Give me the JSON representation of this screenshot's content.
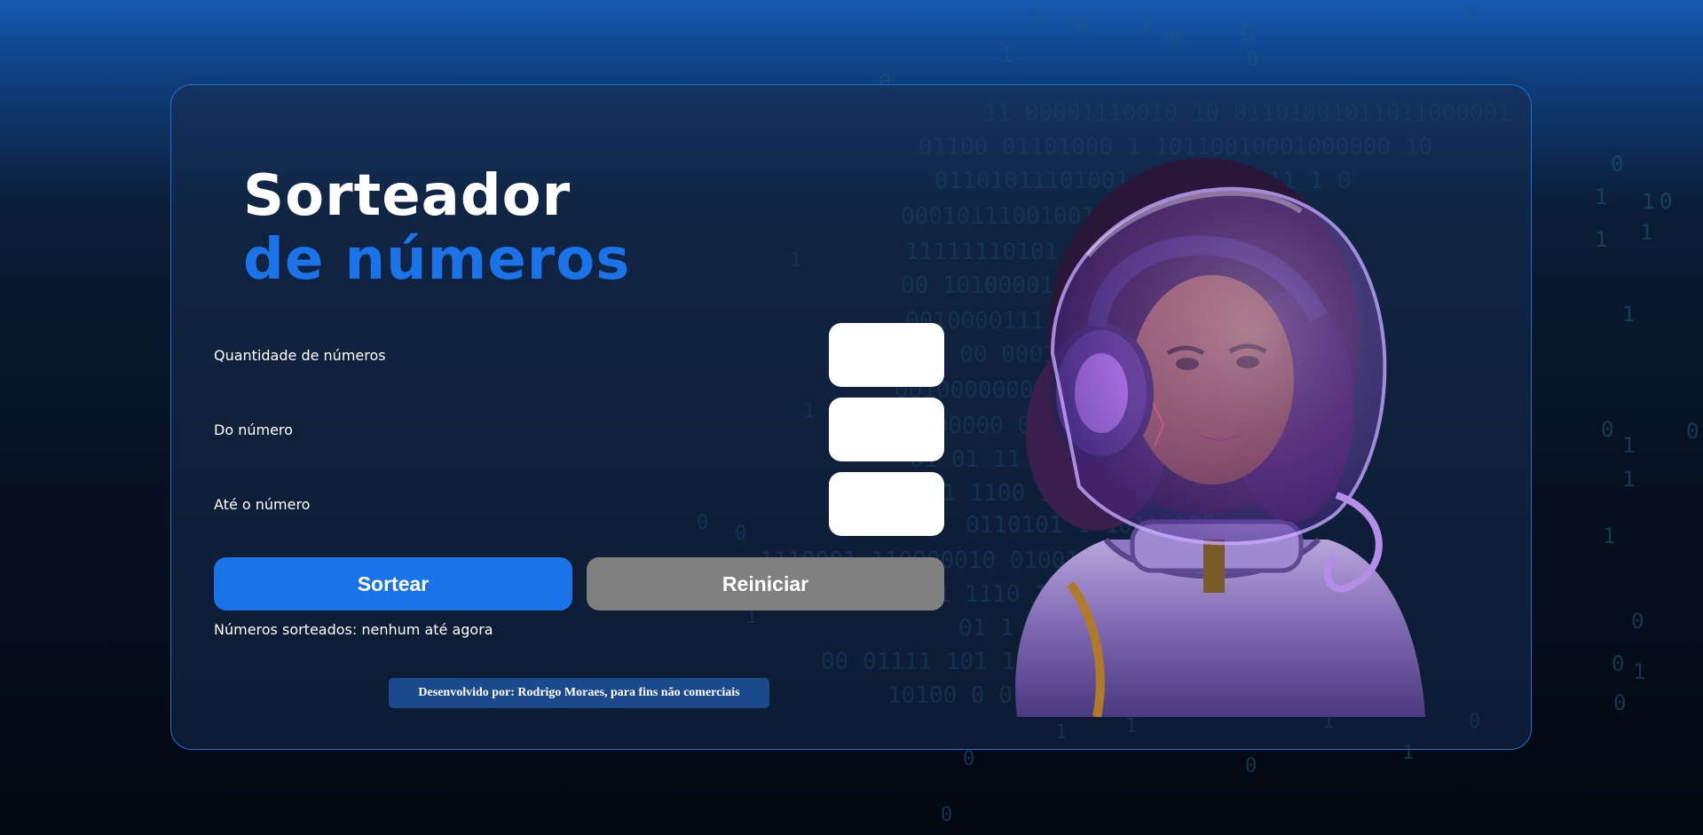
{
  "header": {
    "title_line1": "Sorteador",
    "title_line2": "de números"
  },
  "form": {
    "quantity_label": "Quantidade de números",
    "from_label": "Do número",
    "to_label": "Até o número",
    "quantity_value": "",
    "from_value": "",
    "to_value": ""
  },
  "actions": {
    "draw_label": "Sortear",
    "reset_label": "Reiniciar"
  },
  "result": {
    "text": "Números sorteados: nenhum até agora"
  },
  "footer": {
    "credit": "Desenvolvido por: Rodrigo Moraes, para fins não comerciais"
  },
  "illustration": {
    "icon": "astronaut-illustration"
  },
  "colors": {
    "accent": "#1a73e8",
    "secondary_button": "#808080",
    "card_border": "#1f6fd8",
    "credit_background": "#1a4a8c"
  }
}
